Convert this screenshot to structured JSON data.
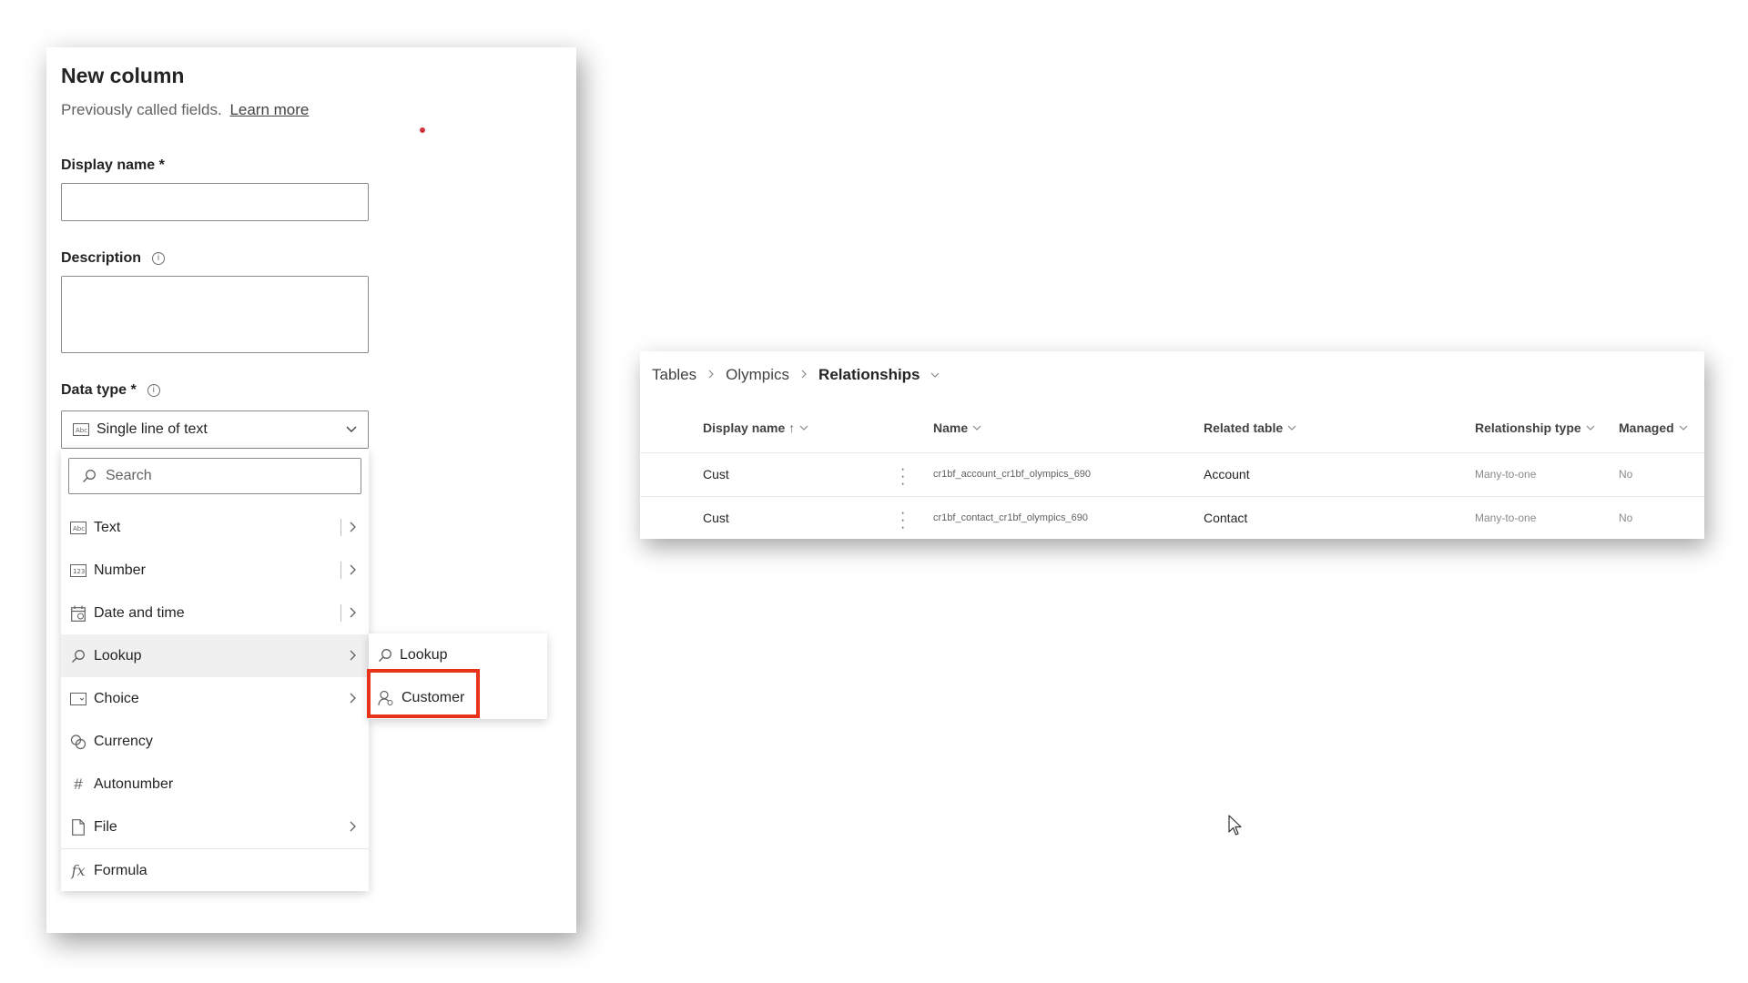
{
  "new_column": {
    "title": "New column",
    "subtitle": "Previously called fields.",
    "learn_more": "Learn more",
    "display_name_label": "Display name *",
    "description_label": "Description",
    "data_type_label": "Data type *",
    "data_type_selected": "Single line of text",
    "search_placeholder": "Search",
    "menu_items": [
      {
        "label": "Text",
        "icon": "text-type-icon"
      },
      {
        "label": "Number",
        "icon": "number-type-icon"
      },
      {
        "label": "Date and time",
        "icon": "calendar-icon"
      },
      {
        "label": "Lookup",
        "icon": "search-icon"
      },
      {
        "label": "Choice",
        "icon": "choice-icon"
      },
      {
        "label": "Currency",
        "icon": "currency-icon"
      },
      {
        "label": "Autonumber",
        "icon": "hash-icon"
      },
      {
        "label": "File",
        "icon": "file-icon"
      },
      {
        "label": "Formula",
        "icon": "fx-icon"
      }
    ],
    "submenu_items": [
      {
        "label": "Lookup",
        "icon": "search-icon"
      },
      {
        "label": "Customer",
        "icon": "person-icon"
      }
    ]
  },
  "relationships": {
    "breadcrumb": [
      "Tables",
      "Olympics",
      "Relationships"
    ],
    "columns": [
      "Display name",
      "Name",
      "Related table",
      "Relationship type",
      "Managed"
    ],
    "rows": [
      {
        "display_name": "Cust",
        "name": "cr1bf_account_cr1bf_olympics_690",
        "related_table": "Account",
        "relationship_type": "Many-to-one",
        "managed": "No"
      },
      {
        "display_name": "Cust",
        "name": "cr1bf_contact_cr1bf_olympics_690",
        "related_table": "Contact",
        "relationship_type": "Many-to-one",
        "managed": "No"
      }
    ]
  },
  "colors": {
    "highlight": "#e8321a",
    "indicator_dot": "#d13438"
  }
}
